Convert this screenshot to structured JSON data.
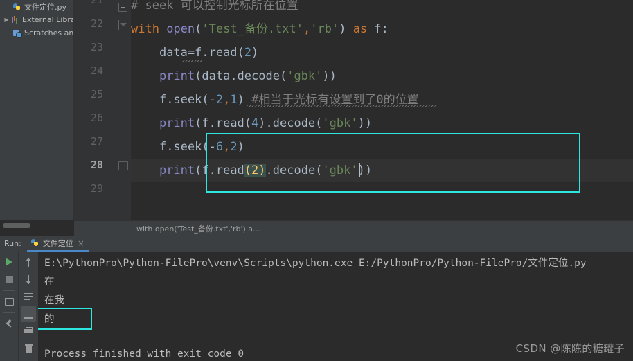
{
  "sidebar": {
    "items": [
      {
        "label": "文件定位.py",
        "icon": "python-file-icon",
        "indent": 1,
        "arrow": ""
      },
      {
        "label": "External Librar",
        "icon": "external-libraries-icon",
        "indent": 0,
        "arrow": "▶"
      },
      {
        "label": "Scratches and",
        "icon": "scratches-icon",
        "indent": 1,
        "arrow": ""
      }
    ]
  },
  "editor": {
    "line_numbers": [
      "21",
      "22",
      "23",
      "24",
      "25",
      "26",
      "27",
      "28",
      "29"
    ],
    "current_line": "28",
    "lines": [
      {
        "num": "21",
        "text": "# seek 可以控制光标所在位置"
      },
      {
        "num": "22",
        "text": "with open('Test_备份.txt','rb') as f:"
      },
      {
        "num": "23",
        "text": "    data=f.read(2)"
      },
      {
        "num": "24",
        "text": "    print(data.decode('gbk'))"
      },
      {
        "num": "25",
        "text": "    f.seek(-2,1) #相当于光标有设置到了0的位置"
      },
      {
        "num": "26",
        "text": "    print(f.read(4).decode('gbk'))"
      },
      {
        "num": "27",
        "text": "    f.seek(-6,2)"
      },
      {
        "num": "28",
        "text": "    print(f.read(2).decode('gbk'))"
      },
      {
        "num": "29",
        "text": ""
      }
    ],
    "tokens": {
      "l21_comment": "# seek 可以控制光标所在位置",
      "l22_kw": "with",
      "l22_fn": "open",
      "l22_paren_open": "(",
      "l22_str1": "'Test_备份.txt'",
      "l22_comma": ",",
      "l22_str2": "'rb'",
      "l22_paren_close": ")",
      "l22_as": " as ",
      "l22_tail": "f:",
      "l23_text": "data=f.read(",
      "l23_num": "2",
      "l23_close": ")",
      "l24_fn": "print",
      "l24_body": "(data.decode(",
      "l24_str": "'gbk'",
      "l24_close": "))",
      "l25_head": "f.seek(-",
      "l25_num1": "2",
      "l25_comma": ",",
      "l25_num2": "1",
      "l25_close": ")",
      "l25_comment": "#相当于光标有设置到了0的位置",
      "l26_fn": "print",
      "l26_body": "(f.read(",
      "l26_num": "4",
      "l26_mid": ").decode(",
      "l26_str": "'gbk'",
      "l26_close": "))",
      "l27_head": "f.seek(-",
      "l27_num1": "6",
      "l27_comma": ",",
      "l27_num2": "2",
      "l27_close": ")",
      "l28_fn": "print",
      "l28_body": "(f.read",
      "l28_br_open": "(",
      "l28_num": "2",
      "l28_br_close": ")",
      "l28_mid": ".decode(",
      "l28_str": "'gbk'",
      "l28_close": "))"
    }
  },
  "breadcrumb": {
    "text": "with open('Test_备份.txt','rb') a..."
  },
  "run_panel": {
    "run_label": "Run:",
    "tab_title": "文件定位",
    "tab_close": "×",
    "toolbar_primary": [
      {
        "name": "run-button",
        "icon": "play-icon"
      },
      {
        "name": "stop-button",
        "icon": "stop-icon"
      },
      {
        "name": "rerun-layout-button",
        "icon": "rerun-icon"
      },
      {
        "name": "pin-tab-button",
        "icon": "pin-icon"
      }
    ],
    "toolbar_secondary": [
      {
        "name": "up-the-stack-trace-button",
        "icon": "arrow-up-icon"
      },
      {
        "name": "down-the-stack-trace-button",
        "icon": "arrow-down-icon"
      },
      {
        "name": "soft-wrap-button",
        "icon": "wrap-icon"
      },
      {
        "name": "scroll-to-end-button",
        "icon": "scroll-to-end-icon"
      },
      {
        "name": "print-button",
        "icon": "print-icon"
      },
      {
        "name": "clear-all-button",
        "icon": "trash-icon"
      }
    ],
    "console_lines": [
      "E:\\PythonPro\\Python-FilePro\\venv\\Scripts\\python.exe E:/PythonPro/Python-FilePro/文件定位.py",
      "在",
      "在我",
      "的",
      "",
      "Process finished with exit code 0"
    ]
  },
  "watermark": {
    "text": "CSDN @陈陈的糖罐子"
  },
  "colors": {
    "editor_bg": "#2b2b2b",
    "panel_bg": "#3c3f41",
    "gutter_bg": "#313335",
    "keyword": "#cc7832",
    "function": "#8888c6",
    "string": "#6a8759",
    "number": "#6897bb",
    "comment": "#808080",
    "default_text": "#a9b7c6",
    "annotation_box": "#2ee6e0",
    "tab_underline": "#4a88c7",
    "run_green": "#59a869"
  }
}
